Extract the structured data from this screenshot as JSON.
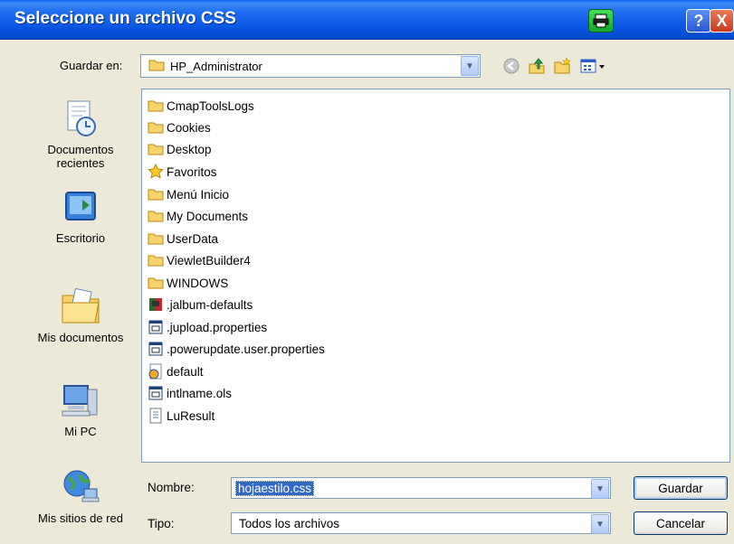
{
  "window": {
    "title": "Seleccione un archivo CSS",
    "help_label": "?",
    "close_label": "X"
  },
  "toolbar": {
    "save_in_label": "Guardar en:",
    "location": "HP_Administrator"
  },
  "places": [
    {
      "label": "Documentos recientes",
      "icon": "recent-documents-icon"
    },
    {
      "label": "Escritorio",
      "icon": "desktop-icon"
    },
    {
      "label": "Mis documentos",
      "icon": "my-documents-icon"
    },
    {
      "label": "Mi PC",
      "icon": "my-computer-icon"
    },
    {
      "label": "Mis sitios de red",
      "icon": "network-places-icon"
    }
  ],
  "files": [
    {
      "name": "CmapToolsLogs",
      "icon": "folder-icon"
    },
    {
      "name": "Cookies",
      "icon": "folder-icon"
    },
    {
      "name": "Desktop",
      "icon": "folder-icon"
    },
    {
      "name": "Favoritos",
      "icon": "star-icon"
    },
    {
      "name": "Menú Inicio",
      "icon": "folder-icon"
    },
    {
      "name": "My Documents",
      "icon": "folder-icon"
    },
    {
      "name": "UserData",
      "icon": "folder-icon"
    },
    {
      "name": "ViewletBuilder4",
      "icon": "folder-icon"
    },
    {
      "name": "WINDOWS",
      "icon": "folder-icon"
    },
    {
      "name": ".jalbum-defaults",
      "icon": "book-icon"
    },
    {
      "name": ".jupload.properties",
      "icon": "properties-file-icon"
    },
    {
      "name": ".powerupdate.user.properties",
      "icon": "properties-file-icon"
    },
    {
      "name": "default",
      "icon": "web-file-icon"
    },
    {
      "name": "intlname.ols",
      "icon": "properties-file-icon"
    },
    {
      "name": "LuResult",
      "icon": "text-file-icon"
    }
  ],
  "form": {
    "filename_label": "Nombre:",
    "filename_value": "hojaestilo.css",
    "filetype_label": "Tipo:",
    "filetype_value": "Todos los archivos",
    "save_button": "Guardar",
    "cancel_button": "Cancelar"
  },
  "colors": {
    "titlebar": "#0856E3",
    "dialog_bg": "#ECE9D8",
    "selection": "#316AC5"
  }
}
